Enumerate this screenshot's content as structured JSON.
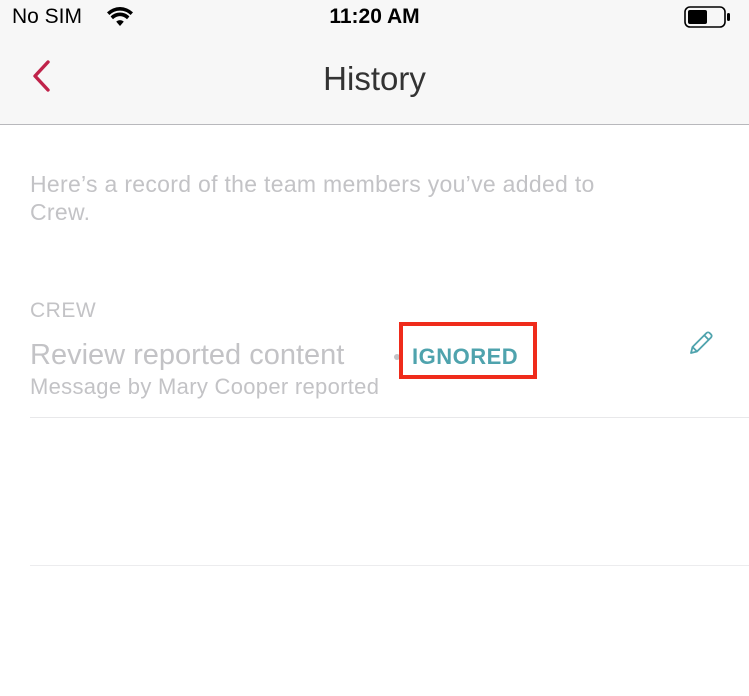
{
  "status_bar": {
    "carrier": "No SIM",
    "time": "11:20 AM"
  },
  "nav": {
    "title": "History",
    "accent_color": "#c0234a"
  },
  "intro": "Here’s a record of the team members you’ve added to Crew.",
  "section": {
    "header": "CREW"
  },
  "history_items": [
    {
      "title": "Review reported content",
      "status": "IGNORED",
      "subtitle": "Message by Mary Cooper reported"
    }
  ],
  "icons": {
    "back": "chevron-left-icon",
    "edit": "pencil-icon",
    "wifi": "wifi-icon",
    "battery": "battery-icon"
  },
  "colors": {
    "status_ignored": "#4fa3ad",
    "muted_text": "#c3c3c6",
    "highlight": "#ef2b1b"
  }
}
